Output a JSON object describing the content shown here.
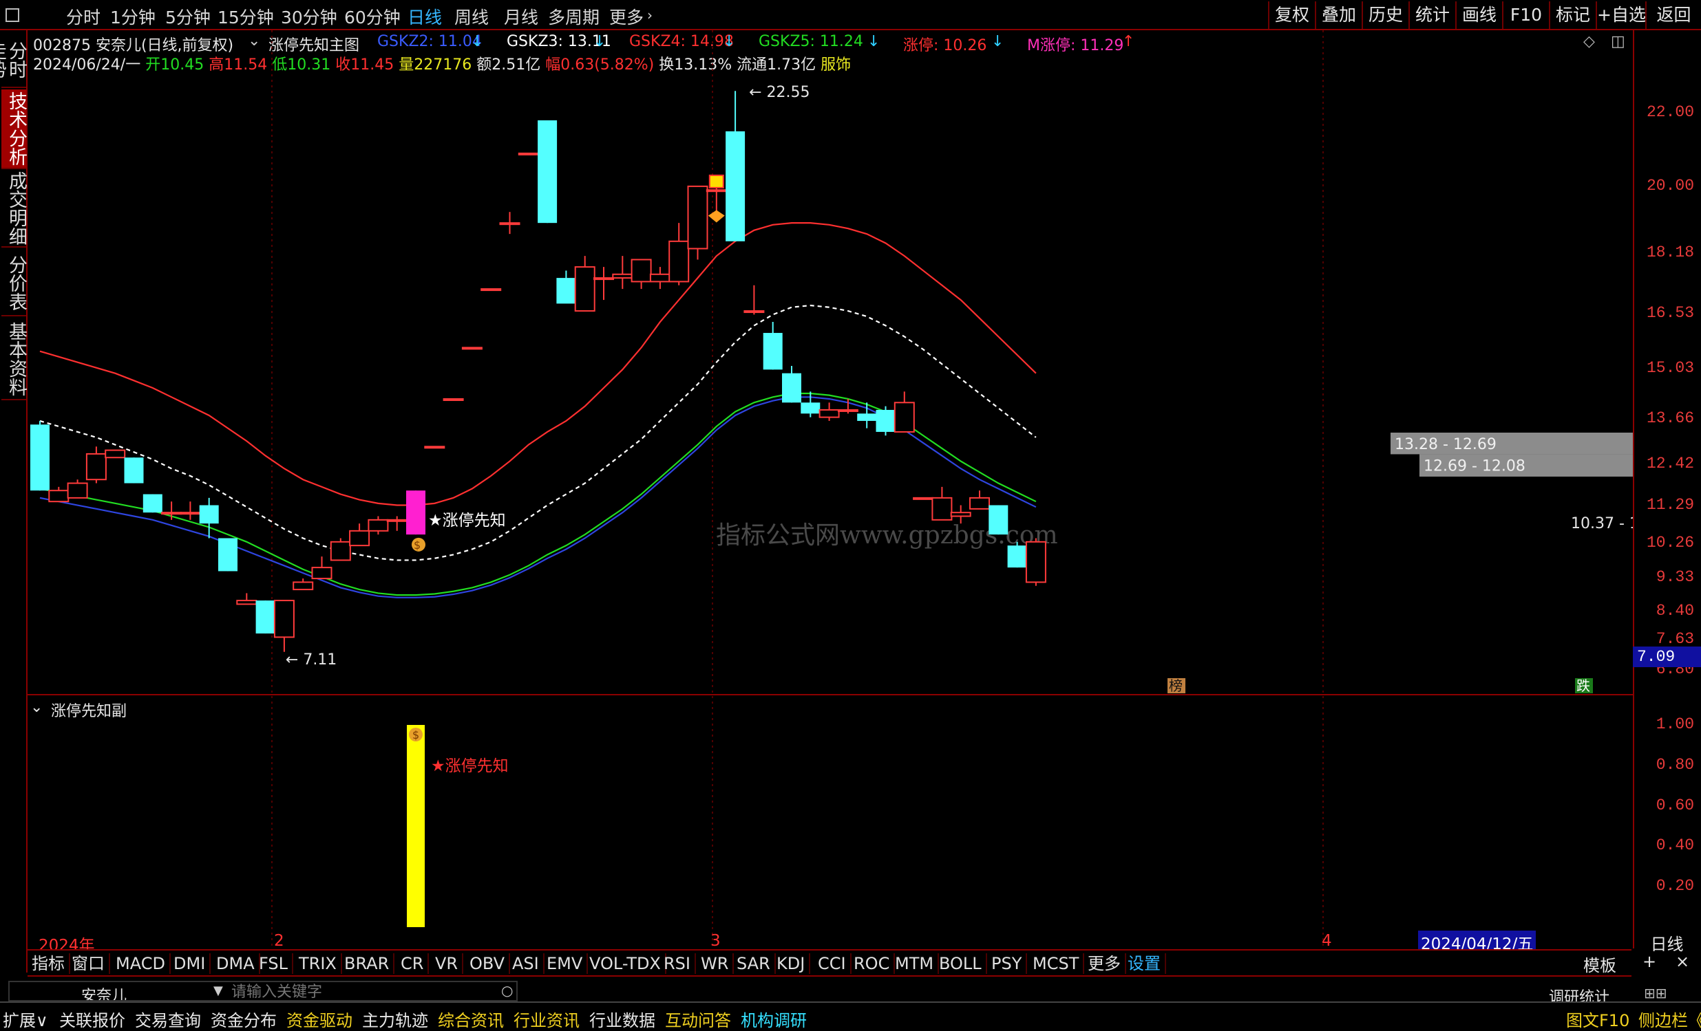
{
  "periods": [
    "分时",
    "1分钟",
    "5分钟",
    "15分钟",
    "30分钟",
    "60分钟",
    "日线",
    "周线",
    "月线",
    "多周期",
    "更多"
  ],
  "active_period": "日线",
  "right_buttons": [
    "复权",
    "叠加",
    "历史",
    "统计",
    "画线",
    "F10",
    "标记",
    "+自选",
    "返回"
  ],
  "left_tabs": [
    "分时走势",
    "技术分析",
    "成交明细",
    "分价表",
    "基本资料"
  ],
  "stock": {
    "code_name": "002875 安奈儿(日线,前复权)",
    "indicator": "涨停先知主图",
    "date": "2024/06/24/一"
  },
  "gskz": [
    {
      "label": "GSKZ2: 11.04",
      "color": "#3a5cff"
    },
    {
      "label": "GSKZ3: 13.11",
      "color": "#ffffff"
    },
    {
      "label": "GSKZ4: 14.98",
      "color": "#ff3030"
    },
    {
      "label": "GSKZ5: 11.24",
      "color": "#22dd22"
    },
    {
      "label": "涨停: 10.26",
      "color": "#ff3030"
    },
    {
      "label": "M涨停: 11.29",
      "color": "#ff2fb8"
    }
  ],
  "quote": {
    "open_label": "开",
    "open": "10.45",
    "high_label": "高",
    "high": "11.54",
    "low_label": "低",
    "low": "10.31",
    "close_label": "收",
    "close": "11.45",
    "vol_label": "量",
    "vol": "227176",
    "amt": "额2.51亿",
    "chg": "幅0.63(5.82%)",
    "turn": "换13.13%",
    "float": "流通1.73亿",
    "sector": "服饰"
  },
  "chart_data": [
    {
      "type": "candlestick",
      "title": "涨停先知主图",
      "y_ticks": [
        "22.00",
        "20.00",
        "18.18",
        "16.53",
        "15.03",
        "13.66",
        "12.42",
        "11.29",
        "10.26",
        "9.33",
        "8.40",
        "7.63",
        "6.80"
      ],
      "ylim": [
        6.6,
        23.3
      ],
      "x_ticks": [
        "2024年",
        "2",
        "3",
        "4"
      ],
      "candles": [
        [
          13.5,
          11.7,
          13.6,
          11.7
        ],
        [
          11.4,
          11.7,
          11.8,
          11.4
        ],
        [
          11.5,
          11.9,
          12.0,
          11.5
        ],
        [
          12.0,
          12.7,
          12.9,
          11.9
        ],
        [
          12.6,
          12.8,
          12.8,
          12.6
        ],
        [
          12.6,
          11.9,
          12.6,
          11.9
        ],
        [
          11.6,
          11.1,
          11.6,
          11.1
        ],
        [
          11.1,
          11.1,
          11.4,
          10.9
        ],
        [
          11.1,
          11.1,
          11.4,
          10.9
        ],
        [
          11.3,
          10.8,
          11.5,
          10.4
        ],
        [
          10.4,
          9.5,
          10.4,
          9.5
        ],
        [
          8.6,
          8.7,
          8.9,
          8.6
        ],
        [
          8.7,
          7.8,
          8.7,
          7.8
        ],
        [
          7.7,
          8.7,
          8.7,
          7.3
        ],
        [
          9.0,
          9.2,
          9.3,
          9.0
        ],
        [
          9.3,
          9.6,
          9.9,
          9.3
        ],
        [
          9.8,
          10.3,
          10.4,
          9.8
        ],
        [
          10.2,
          10.6,
          10.8,
          10.2
        ],
        [
          10.6,
          10.9,
          11.0,
          10.5
        ],
        [
          10.9,
          10.9,
          11.0,
          10.6
        ],
        [
          10.5,
          11.7,
          11.7,
          10.5
        ],
        [
          12.9,
          12.9,
          12.9,
          12.9
        ],
        [
          14.2,
          14.2,
          14.2,
          14.2
        ],
        [
          15.6,
          15.6,
          15.6,
          15.6
        ],
        [
          17.2,
          17.2,
          17.2,
          17.2
        ],
        [
          19.0,
          19.0,
          19.3,
          18.7
        ],
        [
          20.9,
          20.9,
          20.9,
          20.9
        ],
        [
          21.8,
          19.0,
          21.8,
          19.0
        ],
        [
          17.5,
          16.8,
          17.4,
          17.7
        ],
        [
          16.6,
          17.8,
          18.1,
          16.6
        ],
        [
          17.5,
          17.5,
          17.8,
          16.9
        ],
        [
          17.5,
          17.6,
          18.1,
          17.2
        ],
        [
          17.4,
          18.0,
          18.0,
          17.2
        ],
        [
          17.4,
          17.6,
          17.8,
          17.2
        ],
        [
          17.4,
          18.5,
          19.0,
          17.3
        ],
        [
          18.3,
          20.0,
          20.0,
          18.0
        ],
        [
          19.9,
          19.9,
          20.0,
          19.3
        ],
        [
          21.5,
          18.5,
          22.6,
          18.5
        ],
        [
          16.6,
          16.6,
          17.3,
          16.5
        ],
        [
          16.0,
          15.0,
          16.3,
          15.0
        ],
        [
          14.9,
          14.1,
          15.1,
          14.1
        ],
        [
          14.1,
          13.8,
          14.4,
          13.7
        ],
        [
          13.7,
          13.9,
          14.1,
          13.6
        ],
        [
          13.9,
          13.9,
          14.2,
          13.8
        ],
        [
          13.8,
          13.6,
          14.1,
          13.4
        ],
        [
          13.9,
          13.3,
          14.0,
          13.2
        ],
        [
          13.3,
          14.1,
          14.4,
          13.3
        ],
        [
          11.5,
          11.5,
          11.5,
          11.5
        ],
        [
          10.9,
          11.5,
          11.8,
          10.9
        ],
        [
          11.0,
          11.1,
          11.3,
          10.8
        ],
        [
          11.2,
          11.5,
          11.7,
          11.2
        ],
        [
          11.3,
          10.5,
          11.3,
          10.5
        ],
        [
          10.2,
          9.6,
          10.3,
          9.6
        ],
        [
          9.2,
          10.3,
          10.4,
          9.1
        ]
      ],
      "series": [
        {
          "name": "GSKZ4",
          "color": "#ff3030",
          "dash": "",
          "values": [
            15.5,
            15.35,
            15.2,
            15.05,
            14.9,
            14.7,
            14.5,
            14.25,
            14.0,
            13.75,
            13.4,
            13.05,
            12.65,
            12.3,
            12.0,
            11.8,
            11.6,
            11.45,
            11.35,
            11.3,
            11.3,
            11.35,
            11.5,
            11.75,
            12.1,
            12.5,
            12.95,
            13.3,
            13.6,
            14.0,
            14.5,
            15.0,
            15.6,
            16.3,
            16.9,
            17.5,
            18.1,
            18.5,
            18.8,
            18.95,
            19.0,
            19.0,
            18.95,
            18.85,
            18.7,
            18.45,
            18.1,
            17.7,
            17.3,
            16.9,
            16.4,
            15.9,
            15.4,
            14.9
          ]
        },
        {
          "name": "GSKZ3",
          "color": "#ffffff",
          "dash": "6,5",
          "values": [
            13.6,
            13.45,
            13.3,
            13.15,
            12.95,
            12.75,
            12.55,
            12.3,
            12.1,
            11.85,
            11.55,
            11.25,
            10.95,
            10.65,
            10.4,
            10.2,
            10.05,
            9.95,
            9.85,
            9.8,
            9.8,
            9.85,
            9.95,
            10.1,
            10.3,
            10.6,
            10.95,
            11.3,
            11.6,
            11.9,
            12.3,
            12.7,
            13.1,
            13.6,
            14.1,
            14.6,
            15.2,
            15.75,
            16.2,
            16.5,
            16.7,
            16.75,
            16.7,
            16.6,
            16.45,
            16.2,
            15.9,
            15.55,
            15.15,
            14.75,
            14.35,
            13.95,
            13.55,
            13.15
          ]
        },
        {
          "name": "GSKZ5",
          "color": "#22dd22",
          "dash": "",
          "values": [
            11.75,
            11.65,
            11.55,
            11.45,
            11.35,
            11.25,
            11.15,
            11.0,
            10.85,
            10.7,
            10.5,
            10.3,
            10.05,
            9.8,
            9.55,
            9.35,
            9.15,
            9.0,
            8.9,
            8.85,
            8.85,
            8.88,
            8.95,
            9.05,
            9.2,
            9.4,
            9.65,
            9.95,
            10.2,
            10.5,
            10.85,
            11.2,
            11.6,
            12.05,
            12.5,
            12.95,
            13.45,
            13.85,
            14.1,
            14.25,
            14.35,
            14.35,
            14.3,
            14.2,
            14.05,
            13.85,
            13.55,
            13.2,
            12.85,
            12.5,
            12.2,
            11.9,
            11.65,
            11.4
          ]
        },
        {
          "name": "GSKZ2",
          "color": "#2e45e0",
          "dash": "",
          "values": [
            11.5,
            11.4,
            11.3,
            11.2,
            11.1,
            11.0,
            10.9,
            10.75,
            10.6,
            10.45,
            10.25,
            10.05,
            9.85,
            9.65,
            9.45,
            9.25,
            9.05,
            8.92,
            8.82,
            8.78,
            8.78,
            8.8,
            8.87,
            8.97,
            9.12,
            9.32,
            9.57,
            9.85,
            10.1,
            10.4,
            10.75,
            11.1,
            11.5,
            11.95,
            12.4,
            12.85,
            13.35,
            13.75,
            14.0,
            14.15,
            14.25,
            14.25,
            14.2,
            14.1,
            13.95,
            13.7,
            13.35,
            13.0,
            12.65,
            12.3,
            12.0,
            11.75,
            11.5,
            11.25
          ]
        }
      ],
      "zones": [
        {
          "label": "13.28 - 12.69",
          "top": 13.28,
          "bottom": 12.69
        },
        {
          "label": "12.69 - 12.08",
          "top": 12.69,
          "bottom": 12.08
        }
      ],
      "annotations": [
        {
          "text": "22.55",
          "value": 22.55
        },
        {
          "text": "7.11",
          "value": 7.11
        },
        {
          "text": "★涨停先知"
        },
        {
          "text": "10.37 - 1"
        },
        {
          "text": "榜"
        },
        {
          "text": "跌"
        },
        {
          "text": "7.09"
        }
      ],
      "watermark": "指标公式网www.gpzbgs.com"
    },
    {
      "type": "bar",
      "title": "涨停先知副",
      "y_ticks": [
        "1.00",
        "0.80",
        "0.60",
        "0.40",
        "0.20"
      ],
      "ylim": [
        0,
        1.0
      ],
      "bar": {
        "index": 20,
        "value": 1.0,
        "color": "#ffff00"
      },
      "label": "★涨停先知"
    }
  ],
  "date_cursor": "2024/04/12/五",
  "period_label": "日线",
  "bottom_tabs": [
    "指标",
    "窗口",
    "MACD",
    "DMI",
    "DMA",
    "FSL",
    "TRIX",
    "BRAR",
    "CR",
    "VR",
    "OBV",
    "ASI",
    "EMV",
    "VOL-TDX",
    "RSI",
    "WR",
    "SAR",
    "KDJ",
    "CCI",
    "ROC",
    "MTM",
    "BOLL",
    "PSY",
    "MCST",
    "更多",
    "设置"
  ],
  "template_btn": "模板",
  "search": {
    "stock": "安奈儿",
    "placeholder": "请输入关键字"
  },
  "research": "调研统计",
  "status_items": [
    "扩展∨",
    "关联报价",
    "交易查询",
    "资金分布",
    "资金驱动",
    "主力轨迹",
    "综合资讯",
    "行业资讯",
    "行业数据",
    "互动问答",
    "机构调研"
  ],
  "status_right": [
    "图文F10",
    "侧边栏《"
  ]
}
